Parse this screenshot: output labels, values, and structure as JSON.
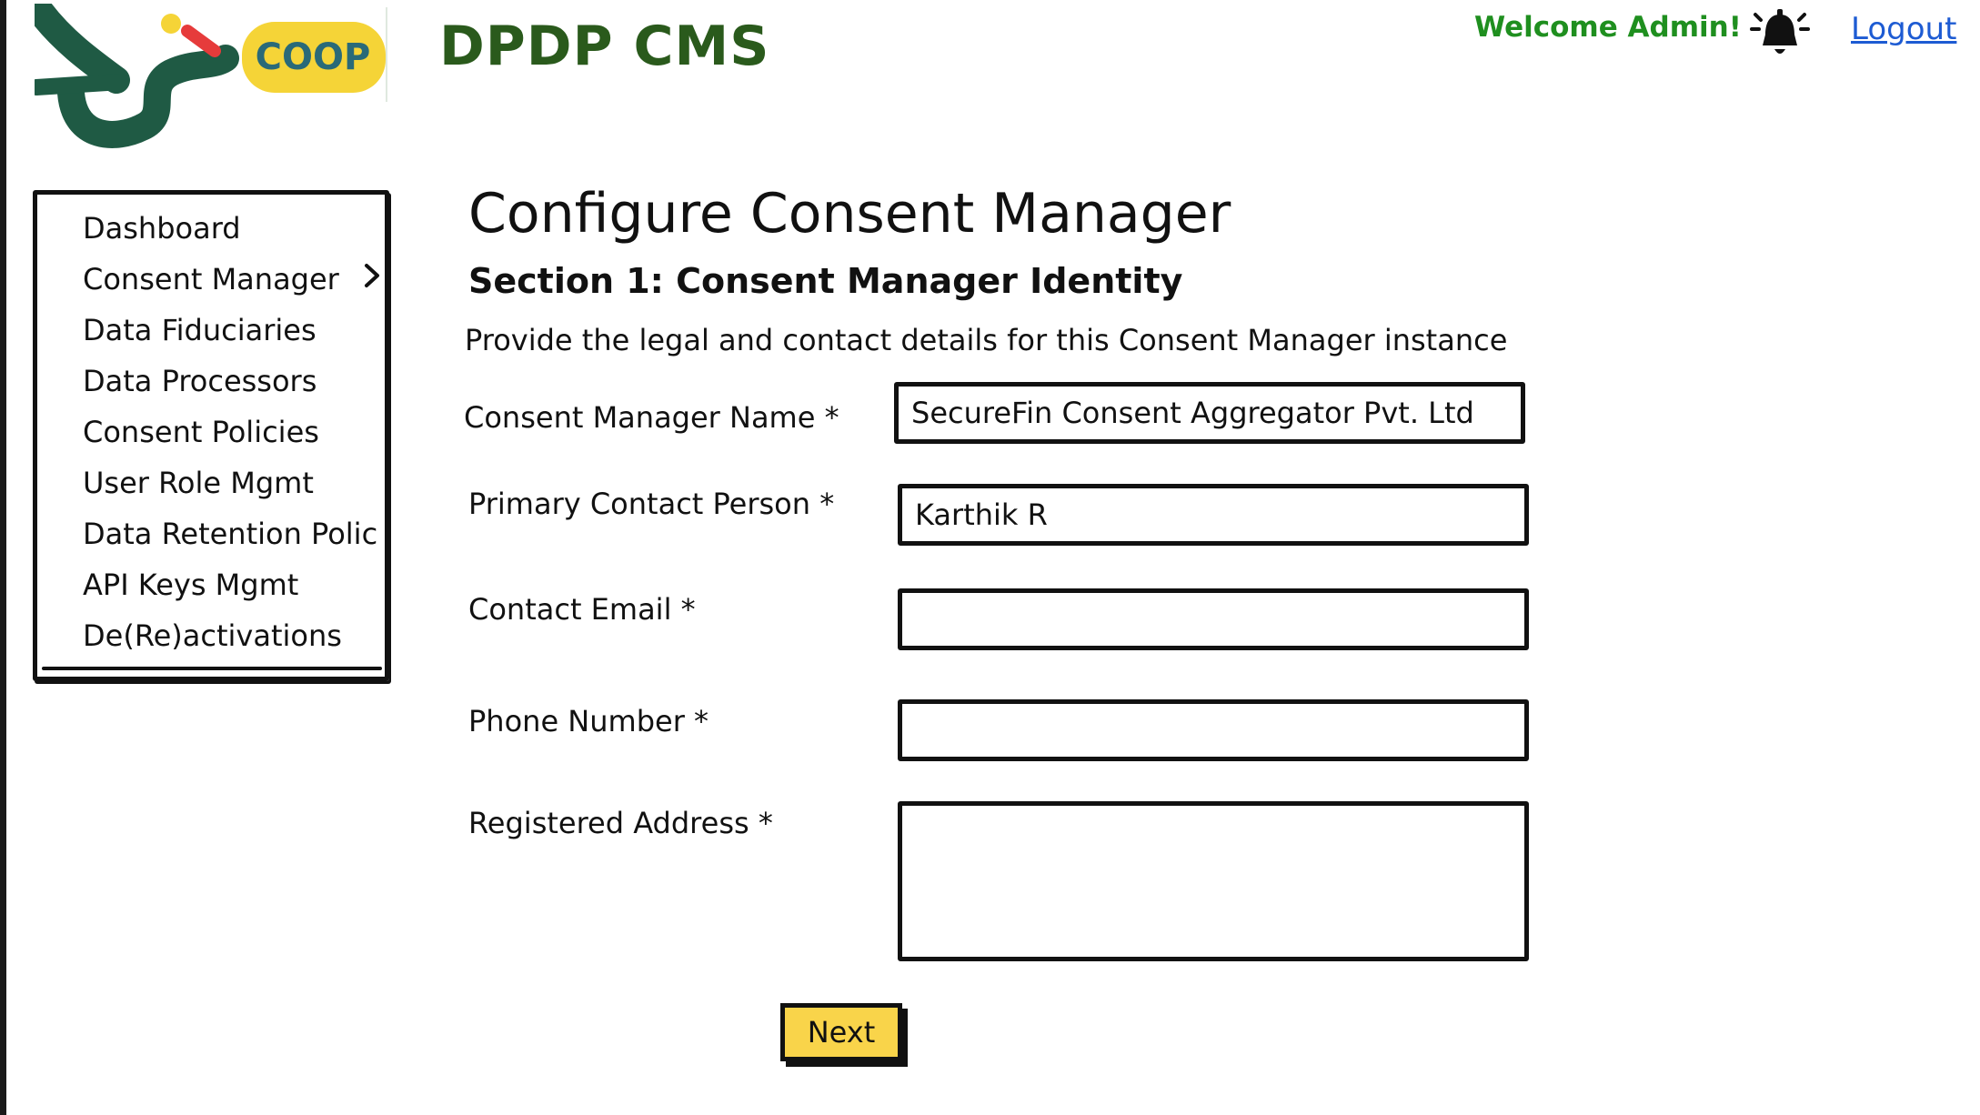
{
  "header": {
    "brand_logo_text": "COOP",
    "app_title": "DPDP CMS",
    "welcome_text": "Welcome Admin!",
    "logout_label": "Logout"
  },
  "sidebar": {
    "items": [
      {
        "label": "Dashboard"
      },
      {
        "label": "Consent Manager"
      },
      {
        "label": "Data Fiduciaries"
      },
      {
        "label": "Data Processors"
      },
      {
        "label": "Consent Policies"
      },
      {
        "label": "User Role Mgmt"
      },
      {
        "label": "Data Retention Polic"
      },
      {
        "label": "API Keys Mgmt"
      },
      {
        "label": "De(Re)activations"
      }
    ]
  },
  "main": {
    "page_title": "Configure Consent Manager",
    "section_title": "Section 1: Consent Manager Identity",
    "section_description": "Provide the legal and contact details for this Consent Manager instance",
    "fields": {
      "name": {
        "label": "Consent Manager Name *",
        "value": "SecureFin Consent Aggregator Pvt. Ltd"
      },
      "contact_person": {
        "label": "Primary Contact Person *",
        "value": "Karthik R"
      },
      "email": {
        "label": "Contact Email *",
        "value": ""
      },
      "phone": {
        "label": "Phone Number *",
        "value": ""
      },
      "address": {
        "label": "Registered Address *",
        "value": ""
      }
    },
    "next_label": "Next"
  },
  "colors": {
    "app_title": "#2a5a1c",
    "welcome": "#1f8f1f",
    "logout_link": "#1d5bd3",
    "next_button": "#f9d44a",
    "logo_green": "#1f5a44",
    "logo_yellow": "#f5d437",
    "logo_red": "#e63b3b"
  },
  "icons": [
    "brand-logo",
    "bell-icon",
    "chevron-right-icon"
  ]
}
